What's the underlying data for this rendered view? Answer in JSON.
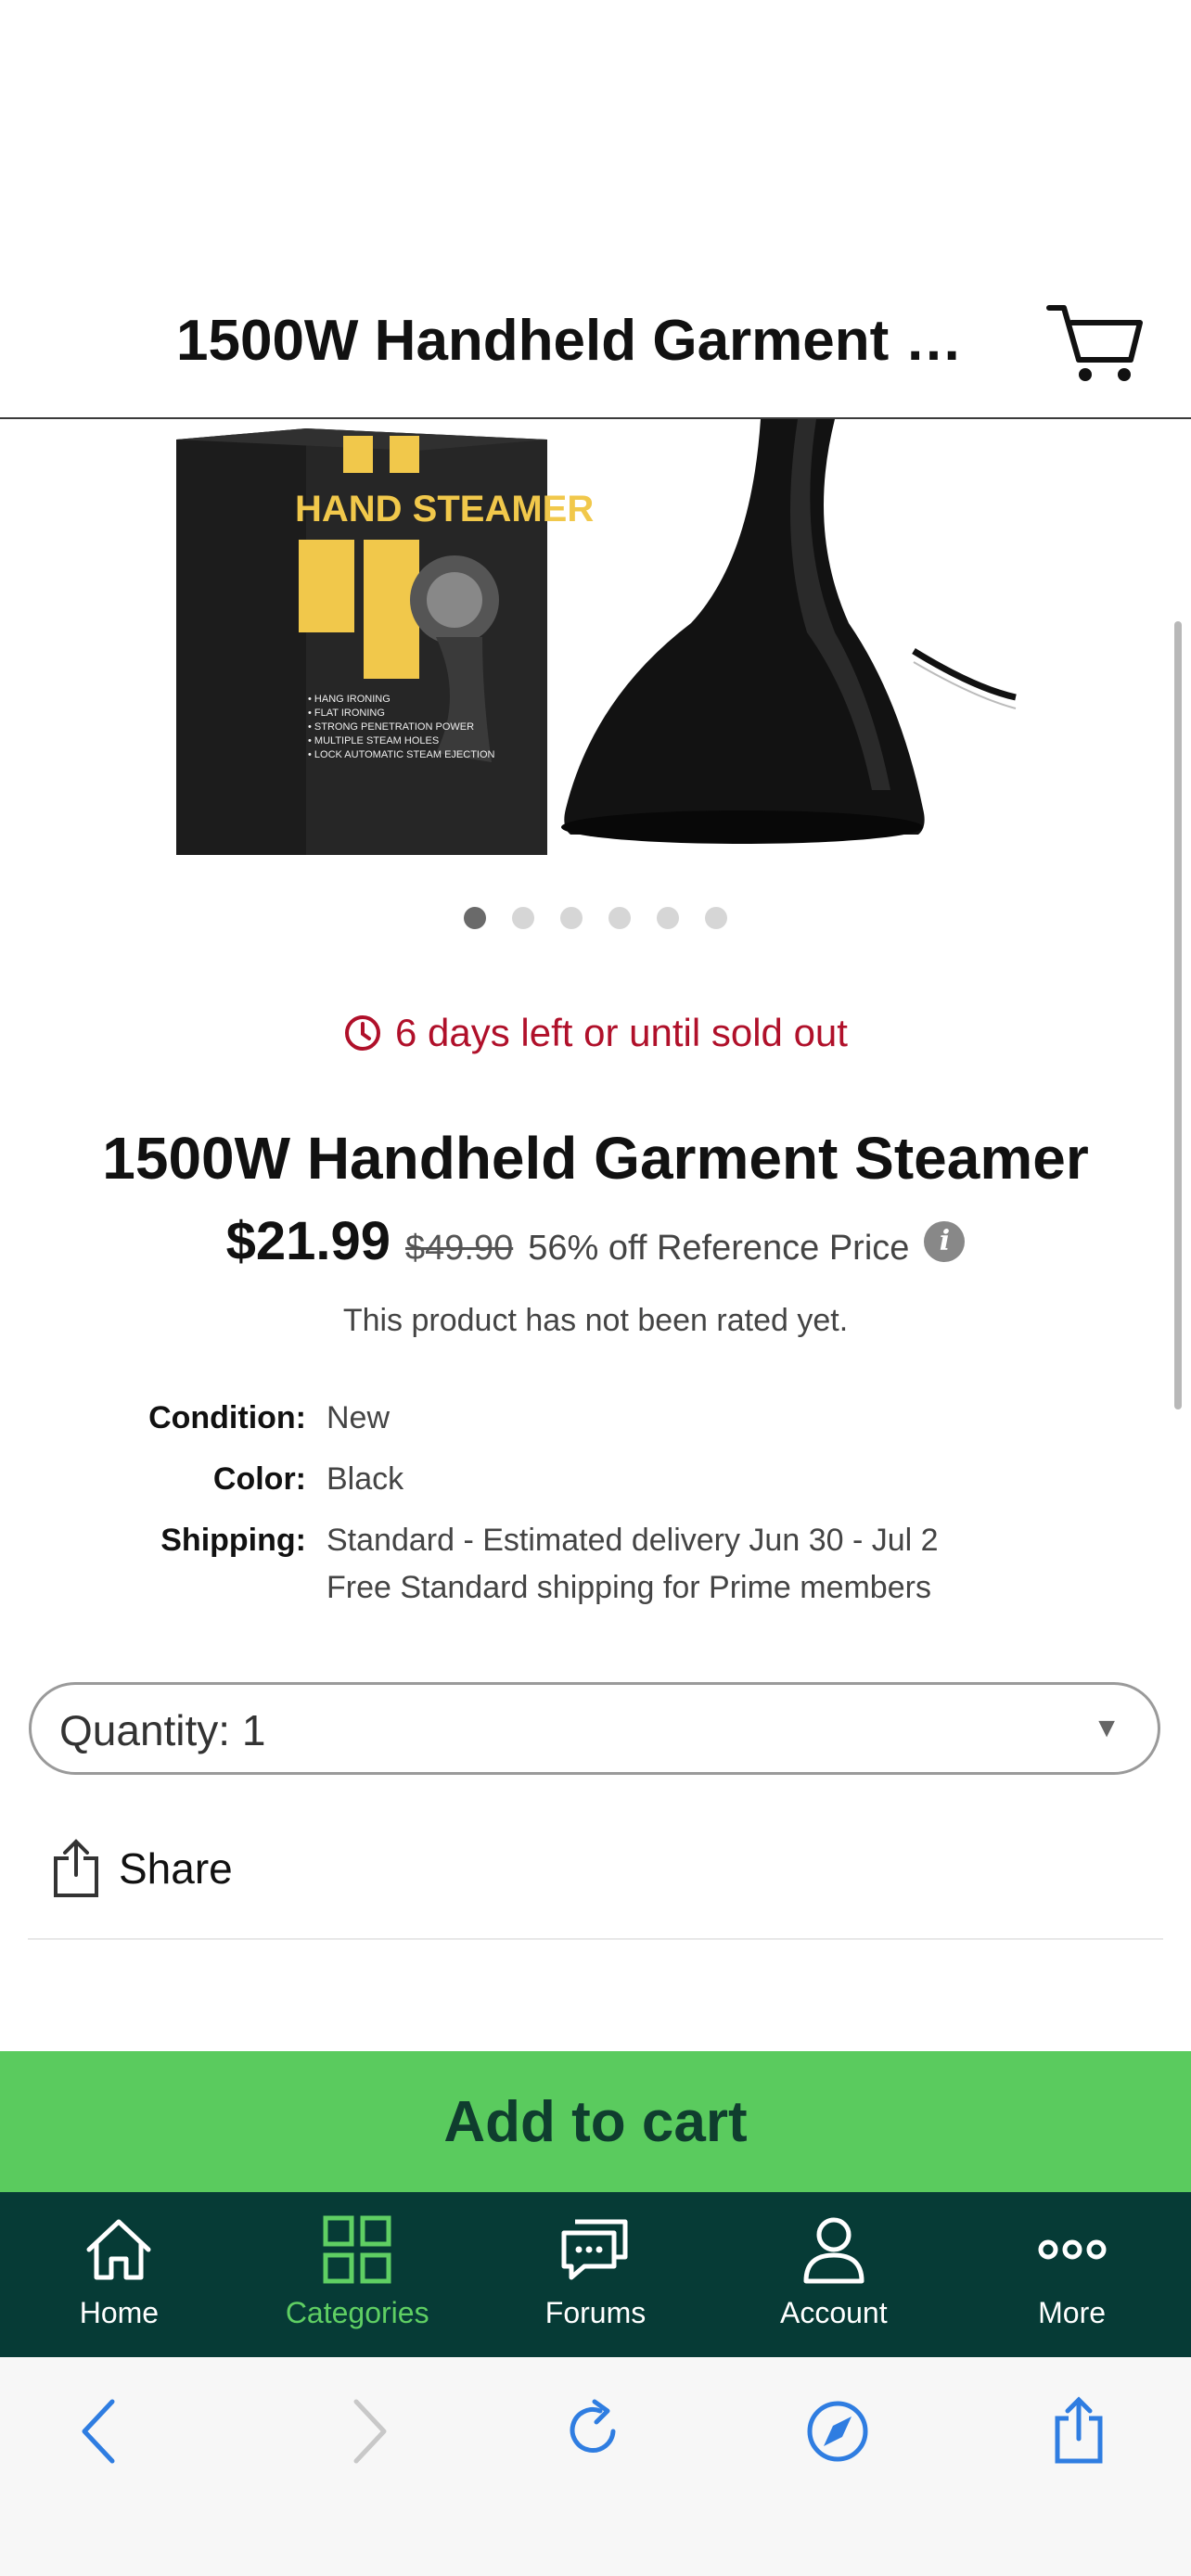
{
  "header": {
    "title": "1500W Handheld Garment Steamer"
  },
  "hero": {
    "box_text": "HAND STEAMER",
    "box_features": [
      "HANG IRONING",
      "FLAT IRONING",
      "STRONG PENETRATION POWER",
      "MULTIPLE STEAM HOLES",
      "LOCK AUTOMATIC STEAM EJECTION"
    ],
    "carousel": {
      "count": 6,
      "active_index": 0
    }
  },
  "deal": {
    "text": "6 days left or until sold out"
  },
  "product": {
    "title": "1500W Handheld Garment Steamer",
    "price": "$21.99",
    "reference_price": "$49.90",
    "discount": "56% off Reference Price",
    "rating_text": "This product has not been rated yet."
  },
  "specs": {
    "condition_label": "Condition:",
    "condition": "New",
    "color_label": "Color:",
    "color": "Black",
    "shipping_label": "Shipping:",
    "shipping_line1": "Standard - Estimated delivery Jun 30 - Jul 2",
    "shipping_line2": "Free Standard shipping for Prime members"
  },
  "quantity": {
    "label": "Quantity: 1"
  },
  "share": {
    "label": "Share"
  },
  "cta": {
    "add_to_cart": "Add to cart"
  },
  "tabbar": {
    "items": [
      {
        "label": "Home",
        "icon": "home-icon",
        "active": false
      },
      {
        "label": "Categories",
        "icon": "grid-icon",
        "active": true
      },
      {
        "label": "Forums",
        "icon": "chat-icon",
        "active": false
      },
      {
        "label": "Account",
        "icon": "person-icon",
        "active": false
      },
      {
        "label": "More",
        "icon": "more-dots-icon",
        "active": false
      }
    ]
  },
  "colors": {
    "accent_green": "#5acb5e",
    "tabbar_bg": "#063b36",
    "deal_red": "#b0102a",
    "browser_blue": "#2f7de1"
  }
}
